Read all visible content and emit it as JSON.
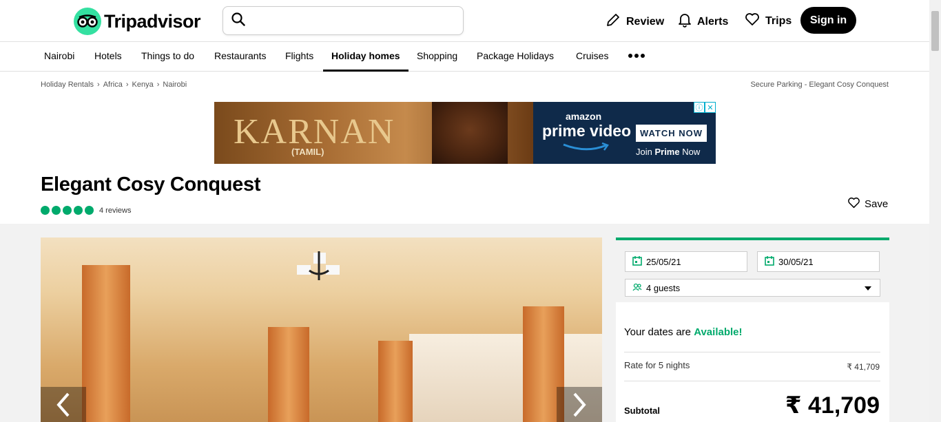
{
  "brand": {
    "logo_text": "Tripadvisor",
    "accent": "#34e0a1"
  },
  "search": {
    "placeholder": "",
    "value": ""
  },
  "topnav": {
    "review": "Review",
    "alerts": "Alerts",
    "trips": "Trips",
    "signin": "Sign in"
  },
  "categories": [
    "Nairobi",
    "Hotels",
    "Things to do",
    "Restaurants",
    "Flights",
    "Holiday homes",
    "Shopping",
    "Package Holidays",
    "Cruises"
  ],
  "active_category": "Holiday homes",
  "breadcrumbs": [
    "Holiday Rentals",
    "Africa",
    "Kenya",
    "Nairobi"
  ],
  "breadcrumb_right": "Secure Parking - Elegant Cosy Conquest",
  "ad": {
    "title": "KARNAN",
    "subtitle": "(TAMIL)",
    "amazon": "amazon",
    "prime": "prime video",
    "watch": "WATCH NOW",
    "join_prefix": "Join ",
    "join_bold": "Prime",
    "join_suffix": " Now"
  },
  "listing": {
    "title": "Elegant Cosy Conquest",
    "rating_bubbles": 5,
    "reviews": "4 reviews",
    "save": "Save"
  },
  "booking": {
    "checkin": "25/05/21",
    "checkout": "30/05/21",
    "guests": "4 guests",
    "avail_prefix": "Your dates are ",
    "avail_status": "Available!",
    "rate_label": "Rate for 5 nights",
    "rate_value": "₹ 41,709",
    "subtotal_label": "Subtotal",
    "subtotal_value": "₹ 41,709"
  },
  "colors": {
    "green": "#00aa6c"
  }
}
